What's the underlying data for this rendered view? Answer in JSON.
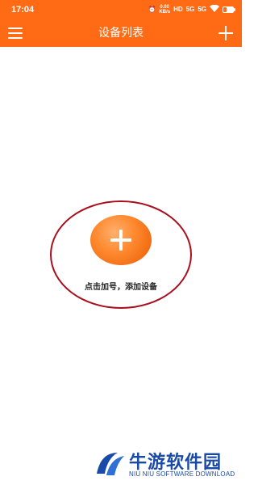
{
  "status_bar": {
    "time": "17:04",
    "net_speed_top": "0.00",
    "net_speed_bottom": "KB/s",
    "hd_label": "HD",
    "signal_1": "5G",
    "signal_2": "5G"
  },
  "app_bar": {
    "title": "设备列表",
    "menu_icon": "hamburger-menu-icon",
    "add_icon": "plus-icon"
  },
  "main": {
    "add_button_icon": "plus-icon",
    "hint": "点击加号，添加设备"
  },
  "watermark": {
    "title": "牛游软件园",
    "subtitle": "NIU NIU SOFTWARE DOWNLOAD"
  },
  "colors": {
    "accent": "#ff6a14",
    "highlight_ring": "#a8101e",
    "watermark": "#1a4aa8"
  }
}
